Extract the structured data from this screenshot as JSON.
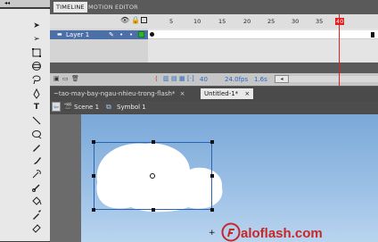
{
  "timeline": {
    "tabs": [
      {
        "label": "TIMELINE",
        "active": true
      },
      {
        "label": "MOTION EDITOR",
        "active": false
      }
    ],
    "ruler": [
      "5",
      "10",
      "15",
      "20",
      "25",
      "30",
      "35",
      "40"
    ],
    "layers": [
      {
        "name": "Layer 1",
        "selected": true
      }
    ],
    "status": {
      "frame": "40",
      "fps": "24.0fps",
      "time": "1.6s"
    }
  },
  "document_tabs": [
    {
      "label": "~tao-may-bay-ngau-nhieu-trong-flash*",
      "active": false
    },
    {
      "label": "Untitled-1*",
      "active": true
    }
  ],
  "editbar": {
    "scene": "Scene 1",
    "symbol": "Symbol 1"
  },
  "watermark": "aloflash.com",
  "colors": {
    "accent": "#4c6fa8",
    "playhead": "#e02020",
    "stage_sky_top": "#7aa8d8",
    "stage_sky_bottom": "#b9d4ef"
  }
}
